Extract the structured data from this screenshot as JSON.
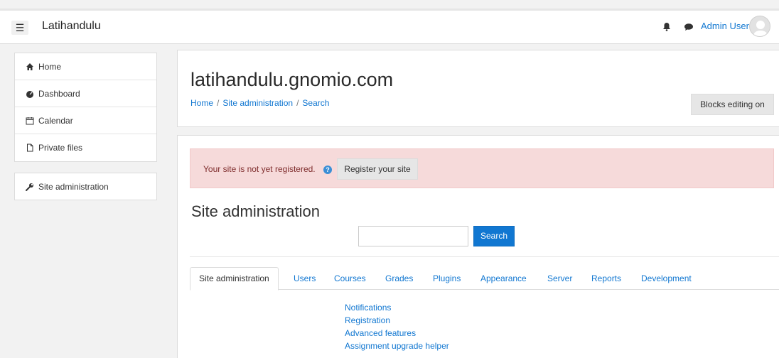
{
  "header": {
    "menu_icon": "☰",
    "site_name": "Latihandulu",
    "user_name": "Admin User",
    "icons": [
      "bell-icon",
      "chat-icon",
      "user-avatar"
    ]
  },
  "nav": {
    "items": [
      {
        "label": "Home",
        "icon": "home-icon"
      },
      {
        "label": "Dashboard",
        "icon": "dashboard-icon"
      },
      {
        "label": "Calendar",
        "icon": "calendar-icon"
      },
      {
        "label": "Private files",
        "icon": "file-icon"
      }
    ],
    "admin": {
      "label": "Site administration",
      "icon": "wrench-icon"
    }
  },
  "page": {
    "title": "latihandulu.gnomio.com",
    "breadcrumb": [
      "Home",
      "Site administration",
      "Search"
    ],
    "breadcrumb_separator": "/",
    "edit_button": "Blocks editing on"
  },
  "alert": {
    "text": "Your site is not yet registered.",
    "help_icon": "?",
    "button": "Register your site"
  },
  "admin": {
    "title": "Site administration",
    "search_value": "",
    "search_button": "Search",
    "tabs": [
      "Site administration",
      "Users",
      "Courses",
      "Grades",
      "Plugins",
      "Appearance",
      "Server",
      "Reports",
      "Development"
    ],
    "links": [
      "Notifications",
      "Registration",
      "Advanced features",
      "Assignment upgrade helper"
    ]
  },
  "colors": {
    "link": "#1177d1",
    "alert_bg": "#f6dada",
    "button_primary": "#1177d1"
  }
}
